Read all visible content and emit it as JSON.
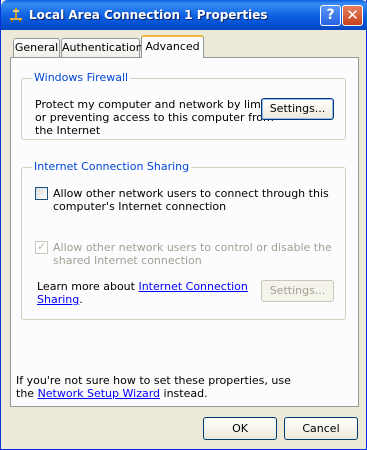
{
  "window": {
    "title": "Local Area Connection 1 Properties",
    "help_glyph": "?",
    "close_glyph": "✕"
  },
  "tabs": [
    {
      "label": "General"
    },
    {
      "label": "Authentication"
    },
    {
      "label": "Advanced"
    }
  ],
  "firewall": {
    "group_label": "Windows Firewall",
    "text_lines": [
      "Protect my computer and network by limiting",
      "or preventing access to this computer from",
      "the Internet"
    ],
    "settings_button": "Settings..."
  },
  "ics": {
    "group_label": "Internet Connection Sharing",
    "allow_connect_lines": [
      "Allow other network users to connect through this",
      "computer's Internet connection"
    ],
    "allow_connect_checked": false,
    "allow_control_lines": [
      "Allow other network users to control or disable the",
      "shared Internet connection"
    ],
    "allow_control_checked": true,
    "learn_prefix": "Learn more about ",
    "learn_link_1": "Internet Connection",
    "learn_link_2": "Sharing",
    "learn_suffix": ".",
    "settings_button": "Settings..."
  },
  "footer": {
    "line1": "If you're not sure how to set these properties, use",
    "line2_prefix": "the ",
    "wizard_link": "Network Setup Wizard",
    "line2_suffix": " instead."
  },
  "buttons": {
    "ok": "OK",
    "cancel": "Cancel"
  },
  "colors": {
    "title_bar": "#0a5fe0",
    "group_label": "#0046d5",
    "link": "#0000ff",
    "active_tab_accent": "#f1b43d"
  }
}
